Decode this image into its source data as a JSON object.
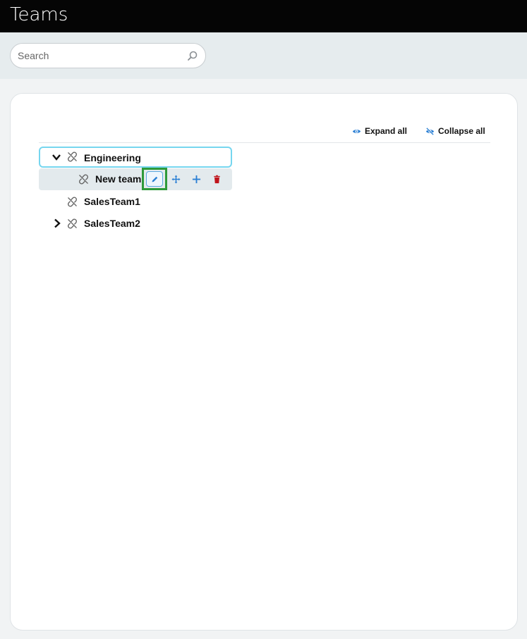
{
  "header": {
    "title": "Teams"
  },
  "search": {
    "placeholder": "Search",
    "value": ""
  },
  "toolbar": {
    "expand_all": "Expand all",
    "collapse_all": "Collapse all"
  },
  "tree": {
    "items": [
      {
        "label": "Engineering",
        "expanded": true,
        "level": 0
      },
      {
        "label": "New team",
        "level": 1
      },
      {
        "label": "SalesTeam1",
        "level": 0
      },
      {
        "label": "SalesTeam2",
        "expanded": false,
        "level": 0
      }
    ]
  },
  "colors": {
    "header_bg": "#050505",
    "accent_blue": "#2a7fd4",
    "delete_red": "#c0141b",
    "focus_outline": "#76d6ef",
    "highlight_green": "#2e9a3a"
  },
  "icons": {
    "search": "search-icon",
    "expand": "eye-icon",
    "collapse": "eye-off-icon",
    "unlink": "unlink-icon",
    "edit": "pencil-icon",
    "move": "move-icon",
    "add": "plus-icon",
    "delete": "trash-icon"
  }
}
